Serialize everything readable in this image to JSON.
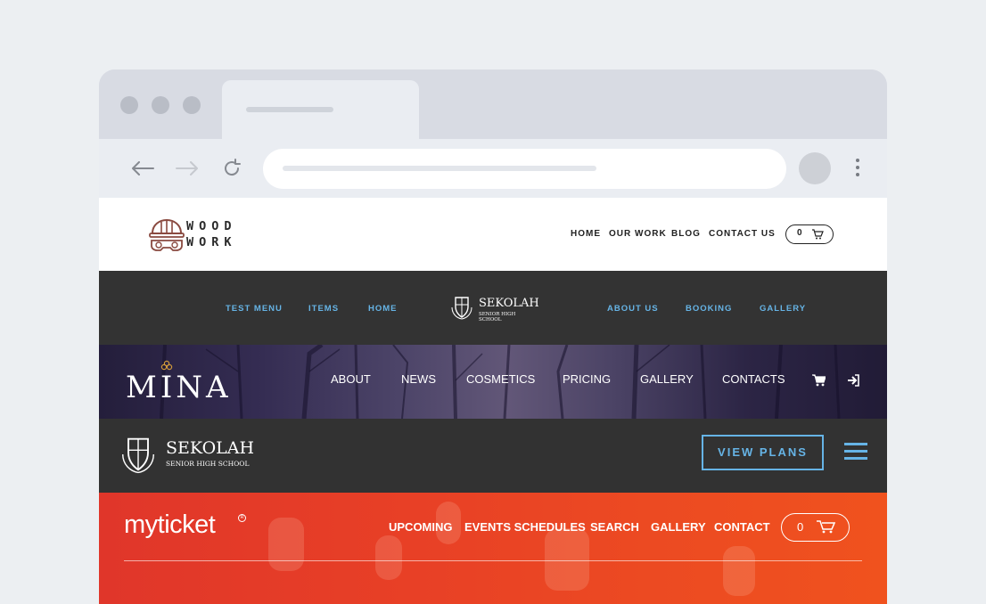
{
  "woodwork": {
    "logo_text_line1": "WOOD",
    "logo_text_line2": "WORK",
    "nav": [
      "HOME",
      "OUR WORK",
      "BLOG",
      "CONTACT US"
    ],
    "cart_count": "0",
    "icons": [
      "hardhat-goggles-logo",
      "cart-icon"
    ]
  },
  "sekolah_nav": {
    "nav_left": [
      "TEST MENU",
      "ITEMS",
      "HOME"
    ],
    "nav_right": [
      "ABOUT US",
      "BOOKING",
      "GALLERY"
    ],
    "logo_name": "SEKOLAH",
    "logo_tagline": "SENIOR HIGH SCHOOL",
    "accent": "#66b4e6",
    "icons": [
      "crest-icon"
    ]
  },
  "mina": {
    "logo": "MINA",
    "nav": [
      "ABOUT",
      "NEWS",
      "COSMETICS",
      "PRICING",
      "GALLERY",
      "CONTACTS"
    ],
    "icons": [
      "cart-icon",
      "login-icon",
      "flower-ornament-icon"
    ]
  },
  "sekolah_plans": {
    "logo_name": "SEKOLAH",
    "logo_tagline": "SENIOR HIGH SCHOOL",
    "button_label": "VIEW PLANS",
    "accent": "#66b4e6",
    "icons": [
      "crest-icon",
      "hamburger-icon"
    ]
  },
  "myticket": {
    "logo": "myticket",
    "logo_mark": "R",
    "nav": [
      "UPCOMING",
      "EVENTS SCHEDULES",
      "SEARCH",
      "GALLERY",
      "CONTACT"
    ],
    "cart_count": "0",
    "accent": "#e84026",
    "icons": [
      "cart-icon"
    ]
  },
  "browser": {
    "icons": [
      "back-arrow-icon",
      "forward-arrow-icon",
      "reload-icon",
      "profile-avatar",
      "more-menu-icon"
    ]
  }
}
